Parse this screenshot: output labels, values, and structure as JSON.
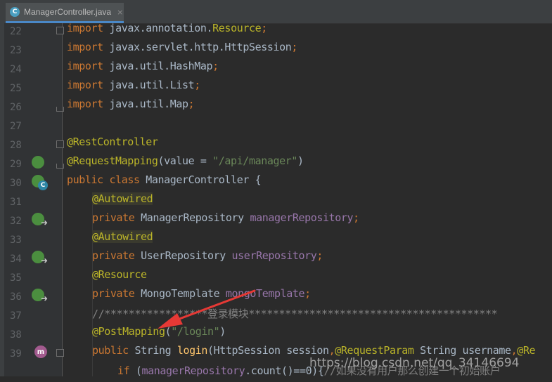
{
  "tab": {
    "icon": "C",
    "label": "ManagerController.java",
    "close": "×"
  },
  "gutter_icons": {
    "bean": "spring-bean-icon",
    "class": "class-icon",
    "method": "method-icon"
  },
  "lines": [
    {
      "no": "22",
      "text": "import javax.annotation.Resource;"
    },
    {
      "no": "23",
      "text": "import javax.servlet.http.HttpSession;"
    },
    {
      "no": "24",
      "text": "import java.util.HashMap;"
    },
    {
      "no": "25",
      "text": "import java.util.List;"
    },
    {
      "no": "26",
      "text": "import java.util.Map;"
    },
    {
      "no": "27",
      "text": ""
    },
    {
      "no": "28",
      "text": "@RestController"
    },
    {
      "no": "29",
      "text": "@RequestMapping(value = \"/api/manager\")"
    },
    {
      "no": "30",
      "text": "public class ManagerController {"
    },
    {
      "no": "31",
      "text": "    @Autowired"
    },
    {
      "no": "32",
      "text": "    private ManagerRepository managerRepository;"
    },
    {
      "no": "33",
      "text": "    @Autowired"
    },
    {
      "no": "34",
      "text": "    private UserRepository userRepository;"
    },
    {
      "no": "35",
      "text": "    @Resource"
    },
    {
      "no": "36",
      "text": "    private MongoTemplate mongoTemplate;"
    },
    {
      "no": "37",
      "text": "    //*****************登录模块*****************************************"
    },
    {
      "no": "38",
      "text": "    @PostMapping(\"/login\")"
    },
    {
      "no": "39",
      "text": "    public String login(HttpSession session,@RequestParam String username,@Re"
    },
    {
      "no": "40",
      "text": "        if (managerRepository.count()==0){//如果没有用户那么创建一个初始账户"
    }
  ],
  "tokens": {
    "import": "import",
    "l22a": "javax.annotation.",
    "l22b": "Resource",
    "l23": "javax.servlet.http.HttpSession",
    "l24": "java.util.HashMap",
    "l25": "java.util.List",
    "l26": "java.util.Map",
    "semi": ";",
    "restController": "@RestController",
    "requestMapping": "@RequestMapping",
    "l29mid": "(value = ",
    "l29str": "\"/api/manager\"",
    "l29end": ")",
    "public": "public",
    "class": "class",
    "className": "ManagerController {",
    "autowired": "@Autowired",
    "private": "private",
    "managerRepoType": "ManagerRepository",
    "managerRepoField": "managerRepository",
    "userRepoType": "UserRepository",
    "userRepoField": "userRepository",
    "resource": "@Resource",
    "mongoType": "MongoTemplate",
    "mongoField": "mongoTemplate",
    "comment37": "//*****************登录模块*****************************************",
    "postMapping": "@PostMapping",
    "l38paren": "(",
    "l38str": "\"/login\"",
    "l38close": ")",
    "stringType": "String",
    "loginMeth": "login",
    "l39a": "(HttpSession session",
    "comma": ",",
    "requestParam": "@RequestParam",
    "l39b": " String username",
    "l39c": "@Re",
    "if": "if",
    "l40a": " (",
    "l40b": "managerRepository",
    "l40c": ".count()==0){",
    "l40cmt": "//如果没有用户那么创建一个初始账户"
  },
  "watermark": "https://blog.csdn.net/qq_34146694",
  "colors": {
    "background": "#2B2B2B",
    "keyword": "#CC7832",
    "annotation": "#BBB529",
    "string": "#6A8759",
    "field": "#9876AA",
    "arrow": "#E53935"
  }
}
